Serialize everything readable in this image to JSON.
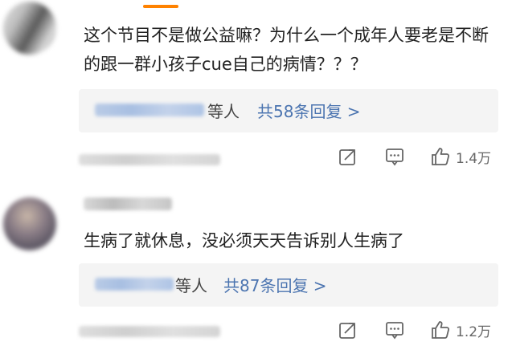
{
  "comments": [
    {
      "text": "这个节目不是做公益嘛？为什么一个成年人要老是不断的跟一群小孩子cue自己的病情？？？",
      "reply_suffix": "等人",
      "reply_link": "共58条回复 >",
      "like_count": "1.4万"
    },
    {
      "text": "生病了就休息，没必须天天告诉别人生病了",
      "reply_suffix": "等人",
      "reply_link": "共87条回复 >",
      "like_count": "1.2万"
    }
  ],
  "colors": {
    "accent": "#ff8200",
    "link": "#4b74b0",
    "reply_bg": "#f4f4f4"
  },
  "icons": [
    "forward-icon",
    "comment-icon",
    "like-icon"
  ]
}
